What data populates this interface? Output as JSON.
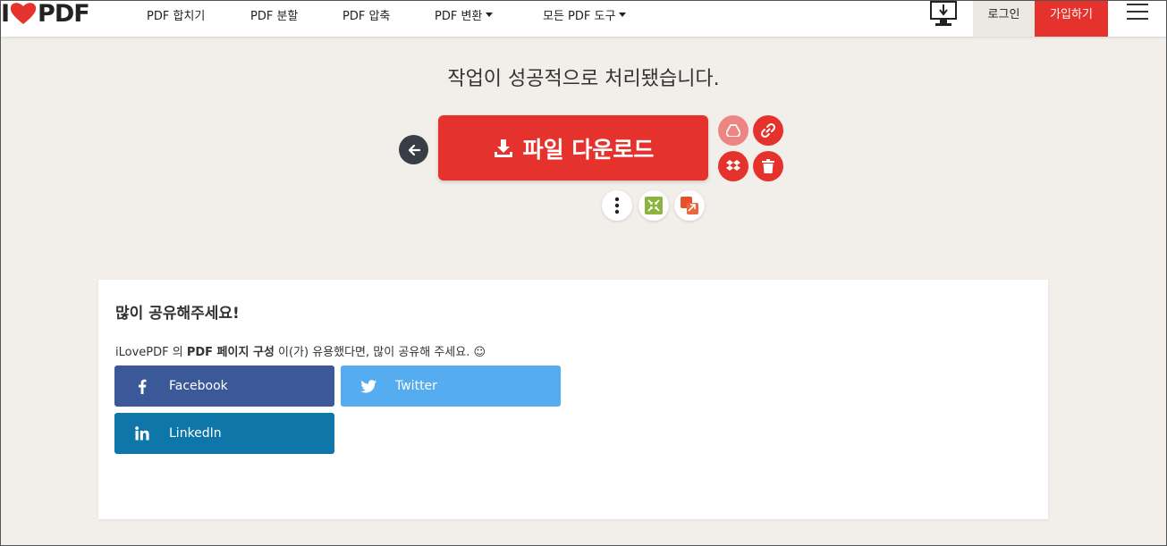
{
  "header": {
    "logo": {
      "prefix": "I",
      "suffix": "PDF"
    },
    "nav": [
      {
        "label": "PDF 합치기",
        "dropdown": false
      },
      {
        "label": "PDF 분할",
        "dropdown": false
      },
      {
        "label": "PDF 압축",
        "dropdown": false
      },
      {
        "label": "PDF 변환",
        "dropdown": true
      },
      {
        "label": "모든 PDF 도구",
        "dropdown": true
      }
    ],
    "login_label": "로그인",
    "signup_label": "가입하기"
  },
  "main": {
    "title": "작업이 성공적으로 처리됐습니다.",
    "download_label": "파일 다운로드"
  },
  "share": {
    "title": "많이 공유해주세요!",
    "text_prefix": "iLovePDF 의 ",
    "text_tool": "PDF 페이지 구성",
    "text_suffix": " 이(가) 유용했다면, 많이 공유해 주세요. ☺",
    "buttons": {
      "facebook": "Facebook",
      "twitter": "Twitter",
      "linkedin": "LinkedIn"
    }
  },
  "colors": {
    "brand_red": "#e5322d",
    "background": "#f2efea",
    "facebook": "#3b5998",
    "twitter": "#55acee",
    "linkedin": "#0e76a8"
  }
}
